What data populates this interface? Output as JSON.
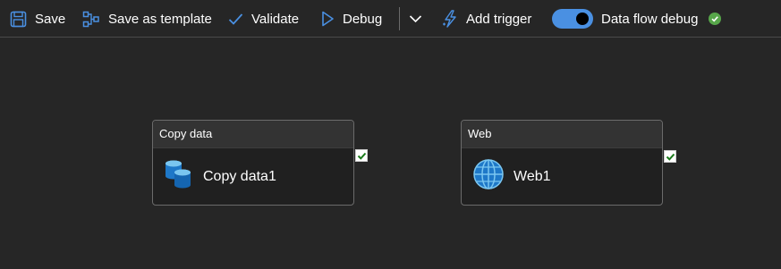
{
  "toolbar": {
    "save_label": "Save",
    "save_as_template_label": "Save as template",
    "validate_label": "Validate",
    "debug_label": "Debug",
    "add_trigger_label": "Add trigger",
    "data_flow_debug_label": "Data flow debug",
    "data_flow_debug_on": true,
    "icons": [
      "save-icon",
      "save-as-template-icon",
      "validate-check-icon",
      "debug-play-icon",
      "chevron-down-icon",
      "trigger-icon",
      "status-ok-icon"
    ]
  },
  "canvas": {
    "activities": [
      {
        "type_label": "Copy data",
        "name": "Copy data1",
        "icon": "copy-data-icon",
        "selected": true
      },
      {
        "type_label": "Web",
        "name": "Web1",
        "icon": "globe-icon",
        "selected": true
      }
    ]
  },
  "colors": {
    "background": "#262626",
    "accent": "#4a90e2",
    "success": "#57a64a",
    "checkbox_check": "#1a7a1a"
  }
}
